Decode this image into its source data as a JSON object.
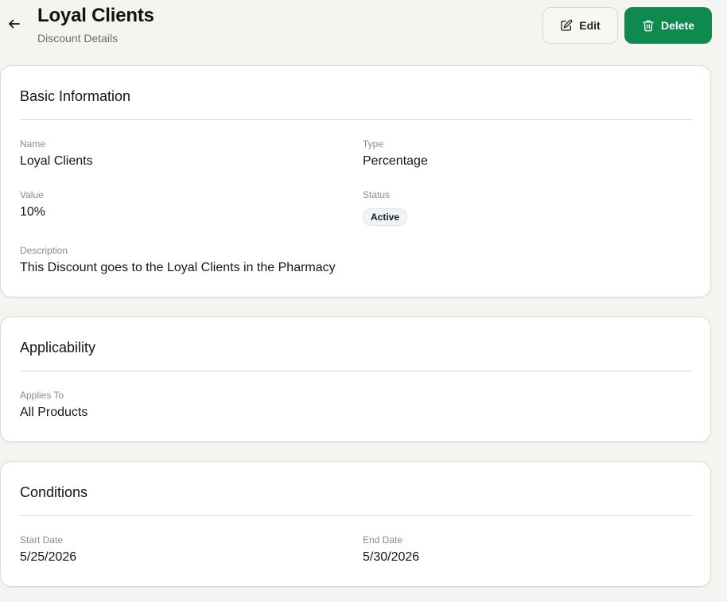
{
  "header": {
    "title": "Loyal Clients",
    "subtitle": "Discount Details",
    "edit_label": "Edit",
    "delete_label": "Delete"
  },
  "basic_information": {
    "heading": "Basic Information",
    "name_label": "Name",
    "name_value": "Loyal Clients",
    "type_label": "Type",
    "type_value": "Percentage",
    "value_label": "Value",
    "value_value": "10%",
    "status_label": "Status",
    "status_value": "Active",
    "description_label": "Description",
    "description_value": "This Discount goes to the Loyal Clients in the Pharmacy"
  },
  "applicability": {
    "heading": "Applicability",
    "applies_to_label": "Applies To",
    "applies_to_value": "All Products"
  },
  "conditions": {
    "heading": "Conditions",
    "start_date_label": "Start Date",
    "start_date_value": "5/25/2026",
    "end_date_label": "End Date",
    "end_date_value": "5/30/2026"
  },
  "colors": {
    "background": "#f5f4f0",
    "primary": "#0f8a4f",
    "border": "#dcdad3",
    "badge_bg": "#eef4f8"
  },
  "icons": {
    "back": "arrow-left-icon",
    "edit": "pencil-square-icon",
    "delete": "trash-icon"
  }
}
